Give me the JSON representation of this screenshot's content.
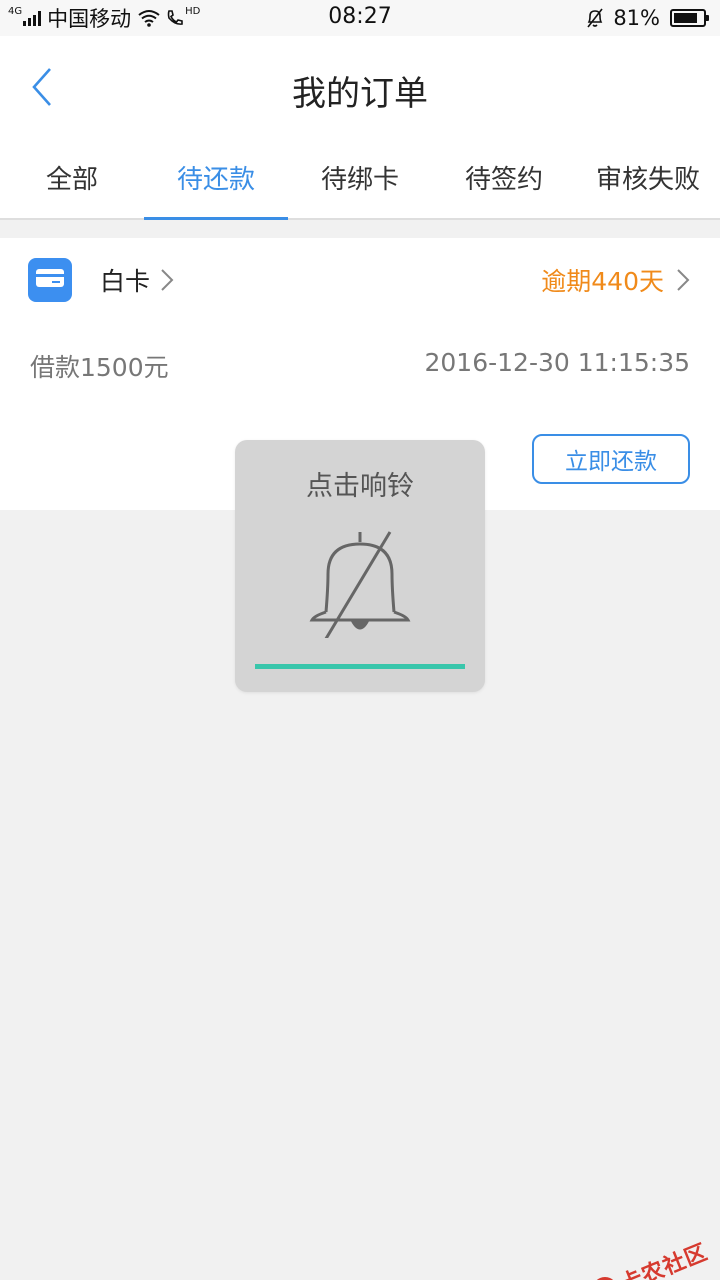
{
  "status_bar": {
    "network": "4G",
    "carrier": "中国移动",
    "call_badge": "HD",
    "time": "08:27",
    "battery_percent": "81%",
    "battery_level": 0.81
  },
  "header": {
    "title": "我的订单"
  },
  "tabs": [
    {
      "label": "全部",
      "active": false
    },
    {
      "label": "待还款",
      "active": true
    },
    {
      "label": "待绑卡",
      "active": false
    },
    {
      "label": "待签约",
      "active": false
    },
    {
      "label": "审核失败",
      "active": false
    }
  ],
  "order": {
    "product_name": "白卡",
    "status": "逾期440天",
    "amount": "借款1500元",
    "time": "2016-12-30 11:15:35",
    "repay_button": "立即还款"
  },
  "toast": {
    "title": "点击响铃",
    "progress": 1.0
  },
  "watermark": {
    "text": "卡农社区"
  },
  "colors": {
    "accent": "#3a8ee6",
    "overdue": "#f08a1a",
    "progress": "#39c6ab",
    "watermark": "#d63a2f"
  },
  "icons": {
    "back": "chevron-left-icon",
    "card": "credit-card-icon",
    "bell": "bell-muted-icon",
    "wifi": "wifi-icon",
    "mute": "bell-off-icon"
  }
}
